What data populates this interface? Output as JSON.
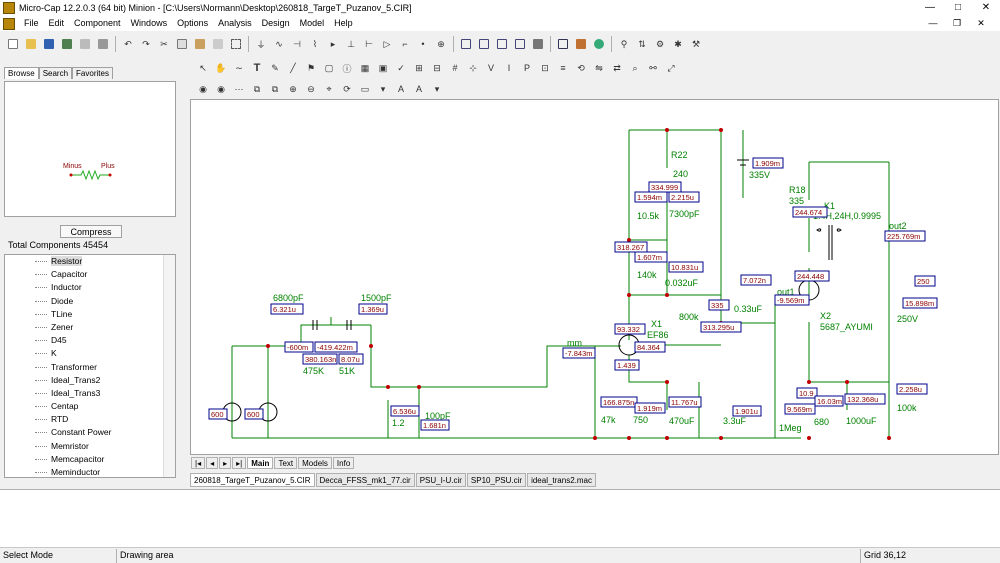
{
  "window": {
    "title": "Micro-Cap 12.2.0.3 (64 bit) Minion - [C:\\Users\\Normann\\Desktop\\260818_TargeT_Puzanov_5.CIR]",
    "min": "—",
    "max": "□",
    "close": "✕"
  },
  "menu": [
    "File",
    "Edit",
    "Component",
    "Windows",
    "Options",
    "Analysis",
    "Design",
    "Model",
    "Help"
  ],
  "mdi": {
    "min": "—",
    "restore": "❐",
    "close": "✕"
  },
  "left": {
    "tabs": [
      "Browse",
      "Search",
      "Favorites"
    ],
    "preview": {
      "minus": "Minus",
      "plus": "Plus"
    },
    "compress": "Compress",
    "total": "Total Components 45454",
    "components": [
      "Resistor",
      "Capacitor",
      "Inductor",
      "Diode",
      "TLine",
      "Zener",
      "D45",
      "K",
      "Transformer",
      "Ideal_Trans2",
      "Ideal_Trans3",
      "Centap",
      "RTD",
      "Constant Power",
      "Memristor",
      "Memcapacitor",
      "Meminductor"
    ]
  },
  "sheet_tabs": [
    "Main",
    "Text",
    "Models",
    "Info"
  ],
  "file_tabs": [
    "260818_TargeT_Puzanov_5.CIR",
    "Decca_FFSS_mk1_77.cir",
    "PSU_I-U.cir",
    "SP10_PSU.cir",
    "ideal_trans2.mac"
  ],
  "status": {
    "mode": "Select Mode",
    "area": "Drawing area",
    "grid": "Grid 36,12"
  },
  "colors": {
    "wire": "#008000",
    "node_box": "#00008b",
    "node_text": "#8b0000",
    "label": "#008000"
  },
  "schematic": {
    "labels": [
      "6800pF",
      "1500pF",
      "475K",
      "51K",
      "100pF",
      "1.2",
      "R22",
      "240",
      "10.5k",
      "7300pF",
      "140k",
      "0.032uF",
      "335V",
      "800k",
      "0.33uF",
      "X1",
      "EF86",
      "R18",
      "335",
      "K1",
      "1.4H,24H,0.9995",
      "out1",
      "out2",
      "X2",
      "5687_AYUMI",
      "250V",
      "47k",
      "750",
      "470uF",
      "3.3uF",
      "1Meg",
      "680",
      "1000uF",
      "100k",
      "mm"
    ],
    "nodes": [
      "6.321u",
      "1.369u",
      "-600m",
      "-419.422m",
      "380.163n",
      "8.07u",
      "6.536u",
      "1.681n",
      "334.999",
      "1.594m",
      "2.215u",
      "318.267",
      "1.607m",
      "10.831u",
      "7.072n",
      "335",
      "313.295u",
      "93.332",
      "84.364",
      "1.439",
      "-7.843m",
      "1.909m",
      "244.674",
      "225.769m",
      "244.448",
      "-9.569m",
      "250",
      "15.898m",
      "10.9",
      "16.03m",
      "9.569m",
      "132.368u",
      "2.258u",
      "166.875n",
      "1.919m",
      "11.767u",
      "1.901u",
      "600",
      "600"
    ]
  }
}
